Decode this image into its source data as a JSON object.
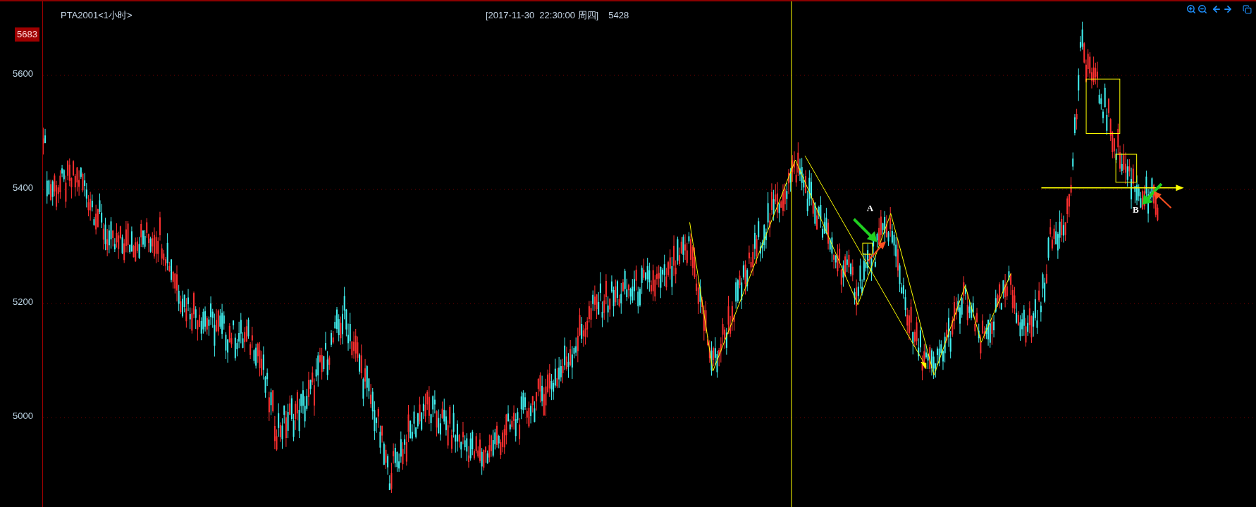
{
  "header": {
    "symbol": "PTA2001<1小时>",
    "timestamp": "[2017-11-30  22:30:00 周四]",
    "price": "5428"
  },
  "current_price_badge": "5683",
  "price_axis": {
    "labels": [
      "5600",
      "5400",
      "5200",
      "5000"
    ]
  },
  "annotations": [
    {
      "label": "A"
    },
    {
      "label": "B"
    }
  ]
}
